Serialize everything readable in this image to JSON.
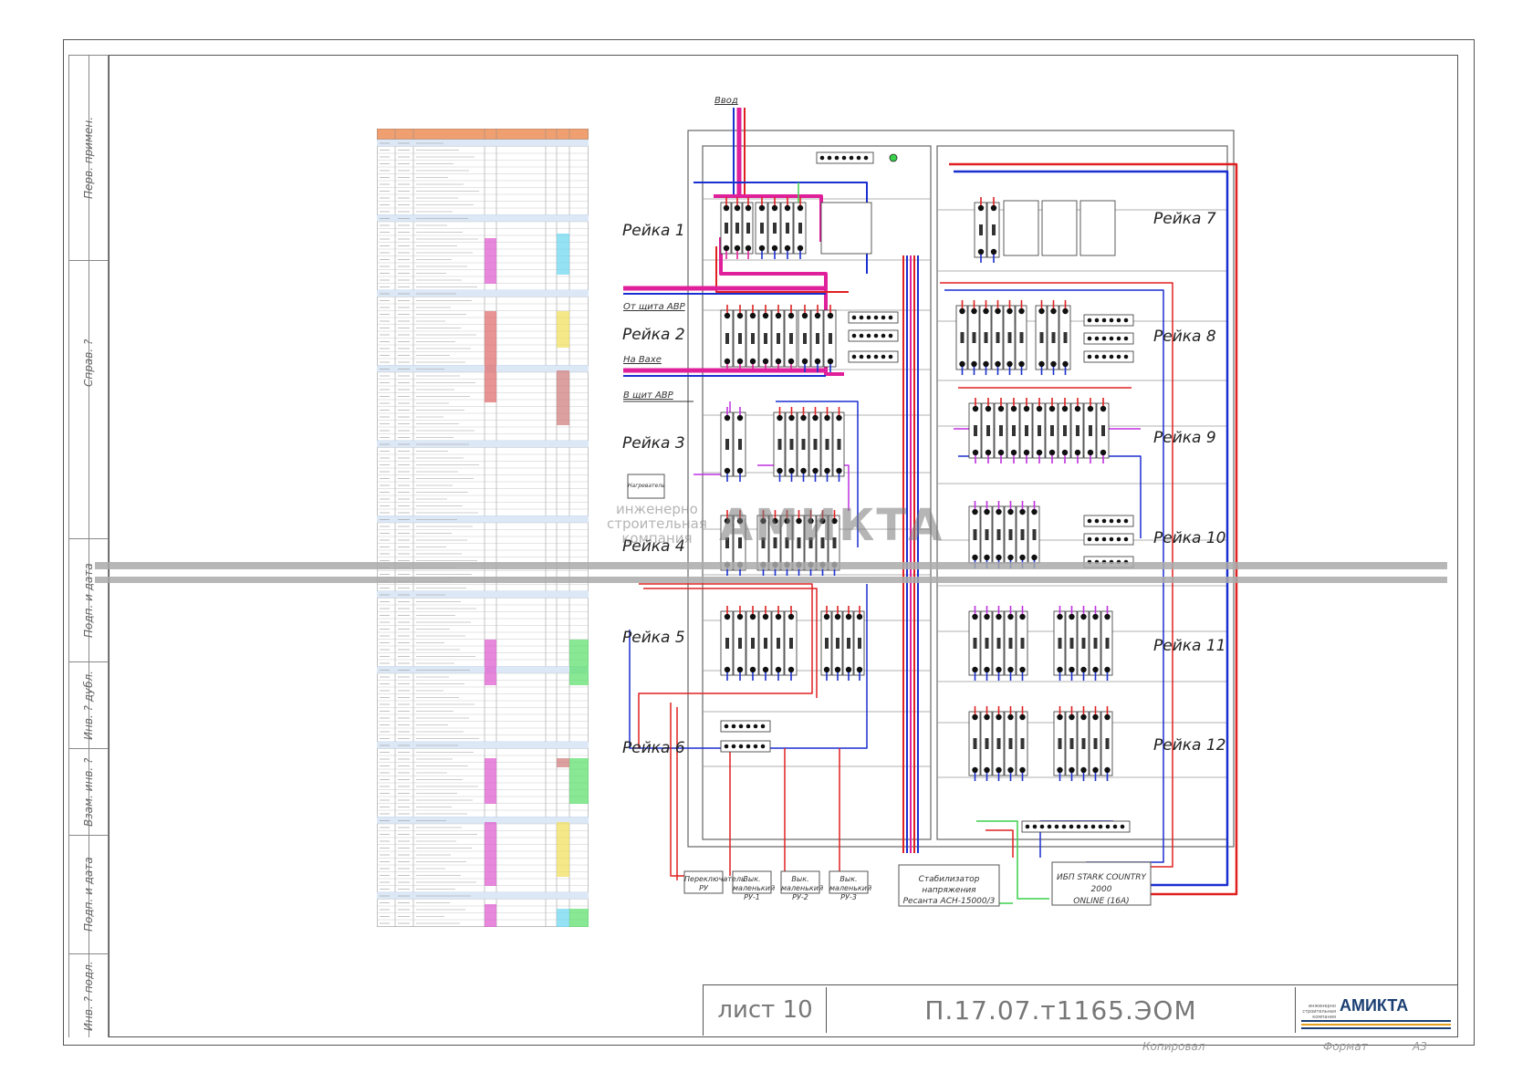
{
  "side_strip": {
    "labels": [
      "Перв. примен.",
      "Справ. ?",
      "Подп. и дата",
      "Инв. ? дубл.",
      "Взам. инв. ?",
      "Подп. и дата",
      "Инв. ? подл."
    ]
  },
  "diagram": {
    "rails_left": [
      "Рейка 1",
      "Рейка 2",
      "Рейка 3",
      "Рейка 4",
      "Рейка 5",
      "Рейка 6"
    ],
    "rails_right": [
      "Рейка 7",
      "Рейка 8",
      "Рейка 9",
      "Рейка 10",
      "Рейка 11",
      "Рейка 12"
    ],
    "input_label": "Ввод",
    "notes": [
      "От щита АВР",
      "На Вахе",
      "В щит АВР"
    ],
    "watermark": {
      "line1": "инженерно",
      "line2": "строительная",
      "line3": "компания",
      "brand": "АМИКТА"
    },
    "bottom_boxes": [
      {
        "text": "Переключатель РУ"
      },
      {
        "text": "Вык. маленький РУ-1"
      },
      {
        "text": "Вык. маленький РУ-2"
      },
      {
        "text": "Вык. маленький РУ-3"
      }
    ],
    "stabilizer": {
      "line1": "Стабилизатор напряжения",
      "line2": "Ресанта АСН-15000/3"
    },
    "ups": {
      "line1": "ИБП STARK COUNTRY 2000",
      "line2": "ONLINE (16А)"
    },
    "left_box": "Нагреватель"
  },
  "title_block": {
    "sheet": "лист 10",
    "code": "П.17.07.т1165.ЭОМ",
    "logo_small": "инженерно строительная компания",
    "logo": "АМИКТА",
    "copied": "Копировал",
    "format_label": "Формат",
    "format_value": "А3"
  },
  "colors": {
    "red": "#e02020",
    "blue": "#1a2fd0",
    "magenta": "#e0209a",
    "violet": "#c030e0",
    "green": "#3ad14a",
    "logo_blue": "#1b3f73",
    "logo_orange": "#e8a020"
  }
}
